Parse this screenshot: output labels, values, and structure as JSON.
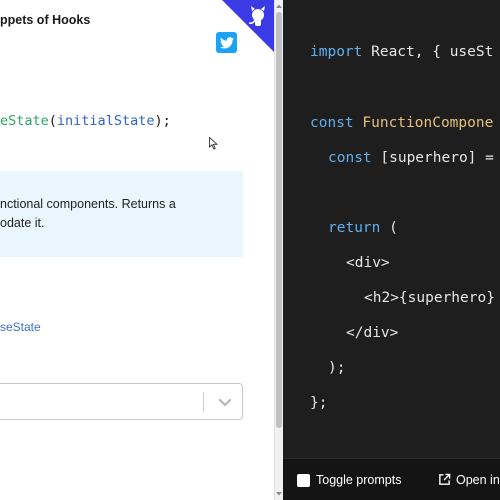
{
  "header": {
    "brand": "ppets of Hooks",
    "twitter_icon": "twitter-icon",
    "github_corner_icon": "github-octocat-icon"
  },
  "doc": {
    "signature": {
      "prefix": "",
      "function": "eState",
      "open": "(",
      "argument": "initialState",
      "close": ");"
    },
    "description_lines": [
      "nctional components. Returns a",
      "odate it."
    ],
    "link_text": "seState",
    "select_value": ""
  },
  "code": {
    "lines": [
      {
        "kw": "import",
        "rest": " React, { useSt"
      },
      {
        "kw": "const",
        "fn": " FunctionCompone",
        "rest": ""
      },
      {
        "kw": "const",
        "rest": " [superhero] ="
      },
      {
        "kw": "return",
        "rest": " ("
      },
      {
        "rest": "<div>"
      },
      {
        "rest": "<h2>{superhero}"
      },
      {
        "rest": "</div>"
      },
      {
        "rest": ");"
      },
      {
        "rest": "};"
      }
    ]
  },
  "bottom_bar": {
    "toggle_label": "Toggle prompts",
    "open_label": "Open in"
  },
  "colors": {
    "info_box_bg": "#eaf6fd",
    "code_bg": "#1e1e1e",
    "keyword": "#61aeee",
    "function_name": "#e5c07b",
    "link": "#3b6fd0",
    "twitter": "#1da1f2",
    "corner": "#3b3be6"
  }
}
